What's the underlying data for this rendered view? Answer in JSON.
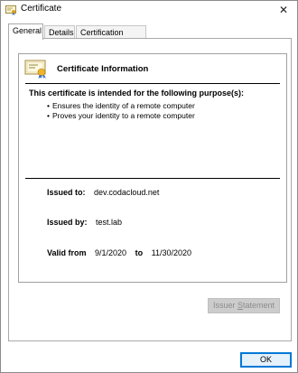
{
  "window": {
    "title": "Certificate",
    "close_glyph": "✕"
  },
  "tabs": [
    {
      "label": "General",
      "active": true
    },
    {
      "label": "Details",
      "active": false
    },
    {
      "label": "Certification Path",
      "active": false
    }
  ],
  "general": {
    "section_title": "Certificate Information",
    "purpose_heading": "This certificate is intended for the following purpose(s):",
    "purposes": [
      "Ensures the identity of a remote computer",
      "Proves your identity to a remote computer"
    ],
    "issued_to_label": "Issued to:",
    "issued_to_value": "dev.codacloud.net",
    "issued_by_label": "Issued by:",
    "issued_by_value": "test.lab",
    "valid_from_label": "Valid from",
    "valid_from_value": "9/1/2020",
    "valid_to_label": "to",
    "valid_to_value": "11/30/2020"
  },
  "buttons": {
    "issuer_statement_prefix": "Issuer ",
    "issuer_statement_underlined": "S",
    "issuer_statement_suffix": "tatement",
    "ok_label": "OK"
  },
  "icons": {
    "title_icon": "certificate-icon",
    "info_icon": "certificate-icon",
    "close_icon": "close-icon"
  },
  "colors": {
    "button_focus_border": "#0078d7",
    "disabled_text": "#8c8c8c"
  }
}
